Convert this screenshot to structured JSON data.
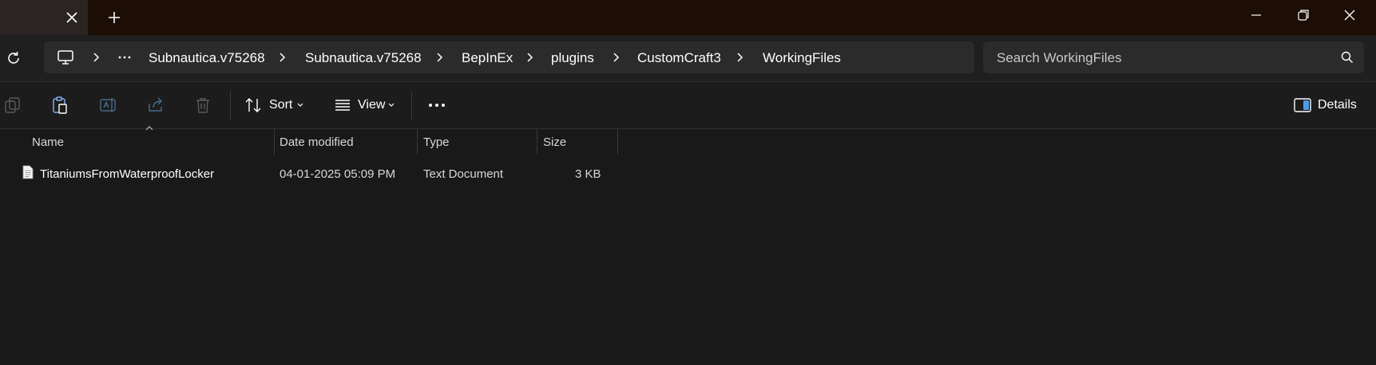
{
  "titlebar": {
    "tab_close_icon": "close-icon",
    "new_tab_icon": "plus-icon",
    "window_buttons": [
      "minimize-icon",
      "restore-icon",
      "close-icon"
    ]
  },
  "address_bar": {
    "refresh_icon": "refresh-icon",
    "breadcrumbs": [
      "Subnautica.v75268",
      "Subnautica.v75268",
      "BepInEx",
      "plugins",
      "CustomCraft3",
      "WorkingFiles"
    ],
    "search_placeholder": "Search WorkingFiles"
  },
  "toolbar": {
    "sort_label": "Sort",
    "view_label": "View",
    "details_label": "Details"
  },
  "columns": {
    "name": "Name",
    "date": "Date modified",
    "type": "Type",
    "size": "Size"
  },
  "files": [
    {
      "name": "TitaniumsFromWaterproofLocker",
      "date": "04-01-2025 05:09 PM",
      "type": "Text Document",
      "size": "3 KB"
    }
  ],
  "colors": {
    "titlebar": "#1c0d05",
    "background": "#191919",
    "field": "#2b2b2b"
  }
}
